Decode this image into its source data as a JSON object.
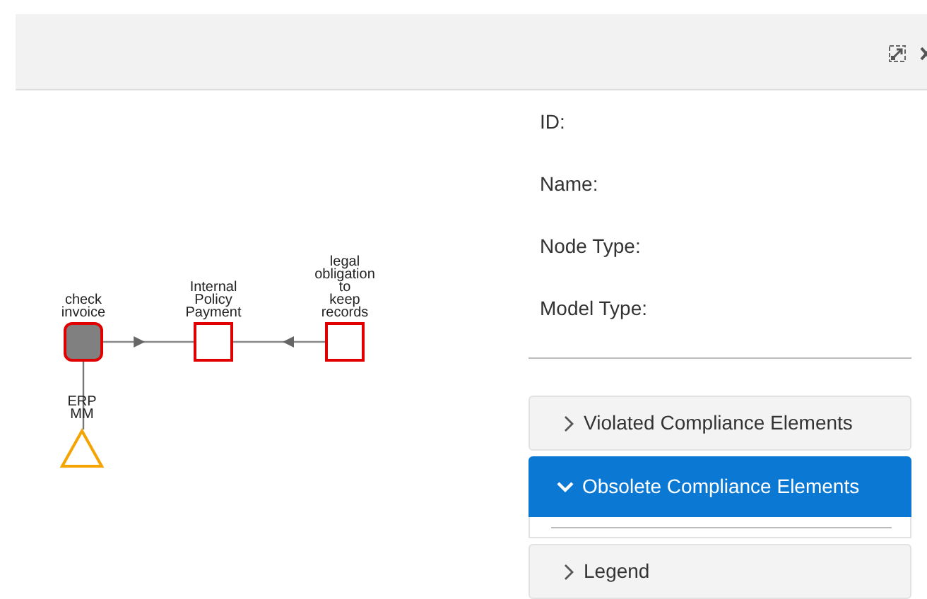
{
  "diagram": {
    "nodes": [
      {
        "kind": "activity",
        "label": "check\ninvoice"
      },
      {
        "kind": "requirement",
        "label": "Internal\nPolicy\nPayment"
      },
      {
        "kind": "requirement",
        "label": "legal\nobligation\nto\nkeep\nrecords"
      },
      {
        "kind": "system",
        "label": "ERP\nMM"
      }
    ],
    "edges": [
      {
        "kind": "arrow"
      },
      {
        "kind": "arrow"
      },
      {
        "kind": "line"
      }
    ]
  },
  "details": {
    "fields": [
      {
        "label": "ID:"
      },
      {
        "label": "Name:"
      },
      {
        "label": "Node Type:"
      },
      {
        "label": "Model Type:"
      }
    ]
  },
  "sections": [
    {
      "label": "Violated Compliance Elements",
      "expanded": false
    },
    {
      "label": "Obsolete Compliance Elements",
      "expanded": true
    },
    {
      "label": "Legend",
      "expanded": false
    }
  ]
}
